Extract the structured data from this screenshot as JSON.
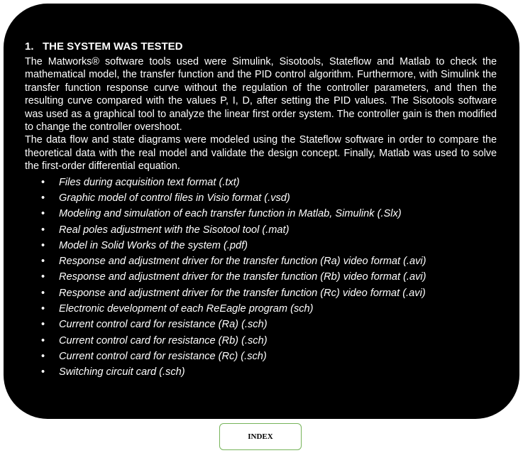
{
  "section": {
    "number": "1.",
    "title": "THE SYSTEM WAS TESTED",
    "paragraph1": "The Matworks® software tools used were Simulink, Sisotools, Stateflow and Matlab to check the mathematical model, the transfer function and the PID control algorithm. Furthermore, with Simulink the transfer function response curve without the regulation of the controller parameters, and then the resulting curve compared with the values P, I, D, after setting the PID values. The Sisotools software was used as a graphical tool to analyze the linear first order system. The controller gain is then modified to change the controller overshoot.",
    "paragraph2": "The data flow and state diagrams were modeled using the Stateflow software in order to compare the theoretical data with the real model and validate the design concept. Finally, Matlab was used to solve the first-order differential equation.",
    "bullet_symbol": "•",
    "items": [
      "Files during acquisition text format (.txt)",
      "Graphic model of control files in Visio format (.vsd)",
      "Modeling and simulation of each transfer function in Matlab, Simulink (.Slx)",
      "Real poles adjustment with  the Sisotool tool (.mat)",
      "Model in Solid Works of the system (.pdf)",
      "Response and adjustment driver for the transfer function (Ra) video format (.avi)",
      "Response and adjustment driver for the transfer function (Rb) video format (.avi)",
      "Response and adjustment driver for the transfer function (Rc) video format (.avi)",
      "Electronic development of each ReEagle program (sch)",
      "Current control card for resistance (Ra) (.sch)",
      "Current control card for resistance (Rb) (.sch)",
      "Current control card for resistance (Rc) (.sch)",
      "Switching circuit card (.sch)"
    ]
  },
  "index_button": {
    "label": "INDEX"
  },
  "colors": {
    "panel_background": "#000000",
    "text": "#ffffff",
    "button_border": "#76b45a"
  }
}
